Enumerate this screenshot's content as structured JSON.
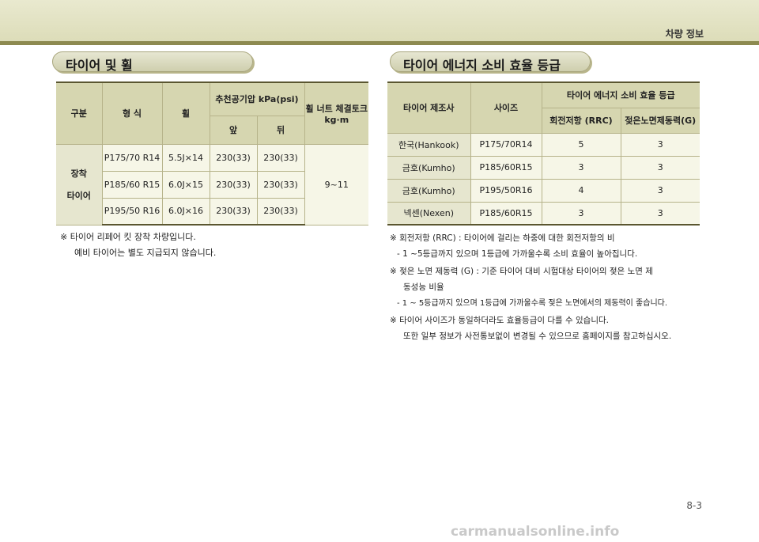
{
  "header": {
    "title": "차량 정보"
  },
  "left_section": {
    "title": "타이어 및 휠",
    "table": {
      "col_category": "구분",
      "col_type": "형 식",
      "col_wheel": "휠",
      "col_pressure": "추천공기압 kPa(psi)",
      "col_torque": "휠 너트 체결토크kg·m",
      "col_front": "앞",
      "col_rear": "뒤",
      "group_line1": "장착",
      "group_line2": "타이어",
      "rows": [
        {
          "type": "P175/70 R14",
          "wheel": "5.5J×14",
          "front": "230(33)",
          "rear": "230(33)"
        },
        {
          "type": "P185/60 R15",
          "wheel": "6.0J×15",
          "front": "230(33)",
          "rear": "230(33)"
        },
        {
          "type": "P195/50 R16",
          "wheel": "6.0J×16",
          "front": "230(33)",
          "rear": "230(33)"
        }
      ],
      "torque_value": "9~11"
    },
    "note_line1": "※  타이어 리페어 킷 장착 차량입니다.",
    "note_line2": "예비 타이어는 별도 지급되지 않습니다."
  },
  "right_section": {
    "title": "타이어 에너지 소비 효율 등급",
    "table": {
      "col_maker": "타이어 제조사",
      "col_size": "사이즈",
      "col_grade": "타이어 에너지 소비 효율 등급",
      "col_rrc": "회전저항 (RRC)",
      "col_wet": "젖은노면제동력(G)",
      "rows": [
        {
          "maker": "한국(Hankook)",
          "size": "P175/70R14",
          "rrc": "5",
          "wet": "3"
        },
        {
          "maker": "금호(Kumho)",
          "size": "P185/60R15",
          "rrc": "3",
          "wet": "3"
        },
        {
          "maker": "금호(Kumho)",
          "size": "P195/50R16",
          "rrc": "4",
          "wet": "3"
        },
        {
          "maker": "넥센(Nexen)",
          "size": "P185/60R15",
          "rrc": "3",
          "wet": "3"
        }
      ]
    },
    "notes": [
      "※ 회전저항 (RRC) : 타이어에 걸리는 하중에 대한 회전저항의 비",
      "- 1 ~5등급까지 있으며 1등급에 가까울수록 소비 효율이 높아집니다.",
      "※  젖은 노면 제동력 (G) : 기준 타이어 대비 시험대상 타이어의 젖은 노면 제",
      "동성능 비율",
      "- 1 ~ 5등급까지 있으며 1등급에 가까울수록 젖은 노면에서의 제동력이 좋습니다.",
      "※  타이어 사이즈가 동일하더라도 효율등급이 다를 수 있습니다.",
      "또한 일부 정보가 사전통보없이 변경될 수 있으므로 홈페이지를 참고하십시오."
    ]
  },
  "page_number": "8-3",
  "watermark": "carmanualsonline.info"
}
